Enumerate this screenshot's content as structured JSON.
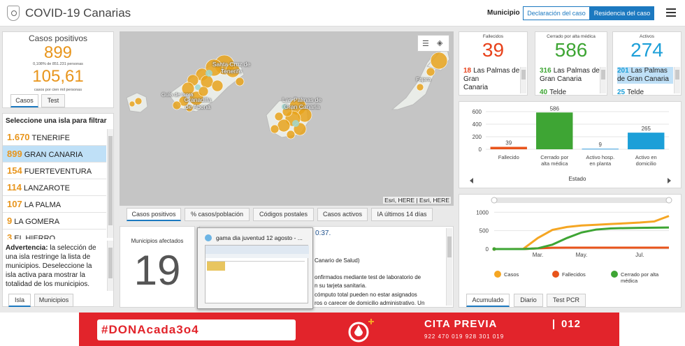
{
  "header": {
    "title": "COVID-19 Canarias",
    "municipio_label": "Municipio",
    "btn_declaracion": "Declaración del caso",
    "btn_residencia": "Residencia del caso"
  },
  "positivos": {
    "title": "Casos positivos",
    "total": "899",
    "pct_line": "0,108% de 851.231 personas",
    "rate": "105,61",
    "rate_caption": "casos por cien mil personas",
    "tabs": [
      "Casos",
      "Test"
    ]
  },
  "islands": {
    "header": "Seleccione una isla para filtrar",
    "items": [
      {
        "count": "1.670",
        "name": "TENERIFE"
      },
      {
        "count": "899",
        "name": "GRAN CANARIA"
      },
      {
        "count": "154",
        "name": "FUERTEVENTURA"
      },
      {
        "count": "114",
        "name": "LANZAROTE"
      },
      {
        "count": "107",
        "name": "LA PALMA"
      },
      {
        "count": "9",
        "name": "LA GOMERA"
      },
      {
        "count": "3",
        "name": "EL HIERRO"
      }
    ],
    "warning_bold": "Advertencia:",
    "warning_text": " la selección de una isla restringe la lista de municipios. Deseleccione la isla activa para mostrar la totalidad de los municipios.",
    "tabs": [
      "Isla",
      "Municipios"
    ]
  },
  "map": {
    "labels": [
      "Santa Cruz de Tenerife",
      "Guía de Isora",
      "Granadilla de Abona",
      "Las Palmas de Gran Canaria",
      "Fajara"
    ],
    "attribution": "Esri, HERE | Esri, HERE",
    "tabs": [
      "Casos positivos",
      "% casos/población",
      "Códigos postales",
      "Casos activos",
      "IA últimos 14 días"
    ]
  },
  "municipios": {
    "label": "Municipios afectados",
    "value": "19"
  },
  "popup": {
    "title": "gama dia juventud 12 agosto - ..."
  },
  "info": {
    "time": "0:37.",
    "lines": [
      "Canario de Salud)",
      "onfirmados mediante test de laboratorio de",
      "n su tarjeta sanitaria.",
      "cómputo total pueden no estar asignados",
      "ros o carecer de domicilio administrativo. Un"
    ]
  },
  "kpis": [
    {
      "label": "Fallecidos",
      "value": "39",
      "color": "#e8421b",
      "rows": [
        {
          "n": "18",
          "t": "Las Palmas de"
        },
        {
          "n": "",
          "t": "Gran"
        },
        {
          "n": "",
          "t": "Canaria"
        }
      ],
      "row_color": "#e8421b"
    },
    {
      "label": "Cerrado por alta médica",
      "value": "586",
      "color": "#3ea534",
      "rows": [
        {
          "n": "316",
          "t": "Las Palmas de"
        },
        {
          "n": "",
          "t": "Gran Canaria"
        },
        {
          "n": "40",
          "t": "Telde"
        }
      ],
      "row_color": "#3ea534"
    },
    {
      "label": "Activos",
      "value": "274",
      "color": "#1c9fd8",
      "rows": [
        {
          "n": "201",
          "t": "Las Palmas de Gran Canaria"
        },
        {
          "n": "25",
          "t": "Telde"
        }
      ],
      "row_color": "#1c9fd8"
    }
  ],
  "chart_data": [
    {
      "type": "bar",
      "categories": [
        "Fallecido",
        "Cerrado por alta médica",
        "Activo hosp. en planta",
        "Activo en domicilio"
      ],
      "values": [
        39,
        586,
        9,
        265
      ],
      "colors": [
        "#e8541b",
        "#3ea534",
        "#3ba0e0",
        "#1c9fd8"
      ],
      "xlabel": "Estado",
      "ylabel": "",
      "ylim": [
        0,
        600
      ],
      "yticks": [
        0,
        200,
        400,
        600
      ]
    },
    {
      "type": "line",
      "x_ticks": [
        "Mar.",
        "May.",
        "Jul."
      ],
      "y_ticks": [
        0,
        500,
        1000
      ],
      "ylim": [
        0,
        1100
      ],
      "series": [
        {
          "name": "Casos",
          "color": "#f5a623",
          "points": [
            [
              0,
              0
            ],
            [
              1,
              0
            ],
            [
              2,
              5
            ],
            [
              3,
              300
            ],
            [
              4,
              520
            ],
            [
              5,
              600
            ],
            [
              6,
              640
            ],
            [
              7,
              660
            ],
            [
              8,
              680
            ],
            [
              9,
              700
            ],
            [
              10,
              720
            ],
            [
              11,
              750
            ],
            [
              12,
              899
            ]
          ]
        },
        {
          "name": "Fallecidos",
          "color": "#e8541b",
          "points": [
            [
              0,
              0
            ],
            [
              1,
              0
            ],
            [
              2,
              0
            ],
            [
              3,
              20
            ],
            [
              4,
              35
            ],
            [
              5,
              37
            ],
            [
              6,
              38
            ],
            [
              7,
              38
            ],
            [
              8,
              39
            ],
            [
              9,
              39
            ],
            [
              10,
              39
            ],
            [
              11,
              39
            ],
            [
              12,
              39
            ]
          ]
        },
        {
          "name": "Cerrado por alta médica",
          "color": "#3ea534",
          "points": [
            [
              0,
              0
            ],
            [
              1,
              0
            ],
            [
              2,
              0
            ],
            [
              3,
              20
            ],
            [
              4,
              120
            ],
            [
              5,
              300
            ],
            [
              6,
              450
            ],
            [
              7,
              530
            ],
            [
              8,
              560
            ],
            [
              9,
              570
            ],
            [
              10,
              575
            ],
            [
              11,
              580
            ],
            [
              12,
              586
            ]
          ]
        }
      ],
      "tabs": [
        "Acumulado",
        "Diario",
        "Test PCR"
      ]
    }
  ],
  "banner": {
    "hashtag": "#DONAcada3o4",
    "cita": "CITA PREVIA",
    "tel": "012",
    "sub": "922 470 019   928 301 019"
  }
}
